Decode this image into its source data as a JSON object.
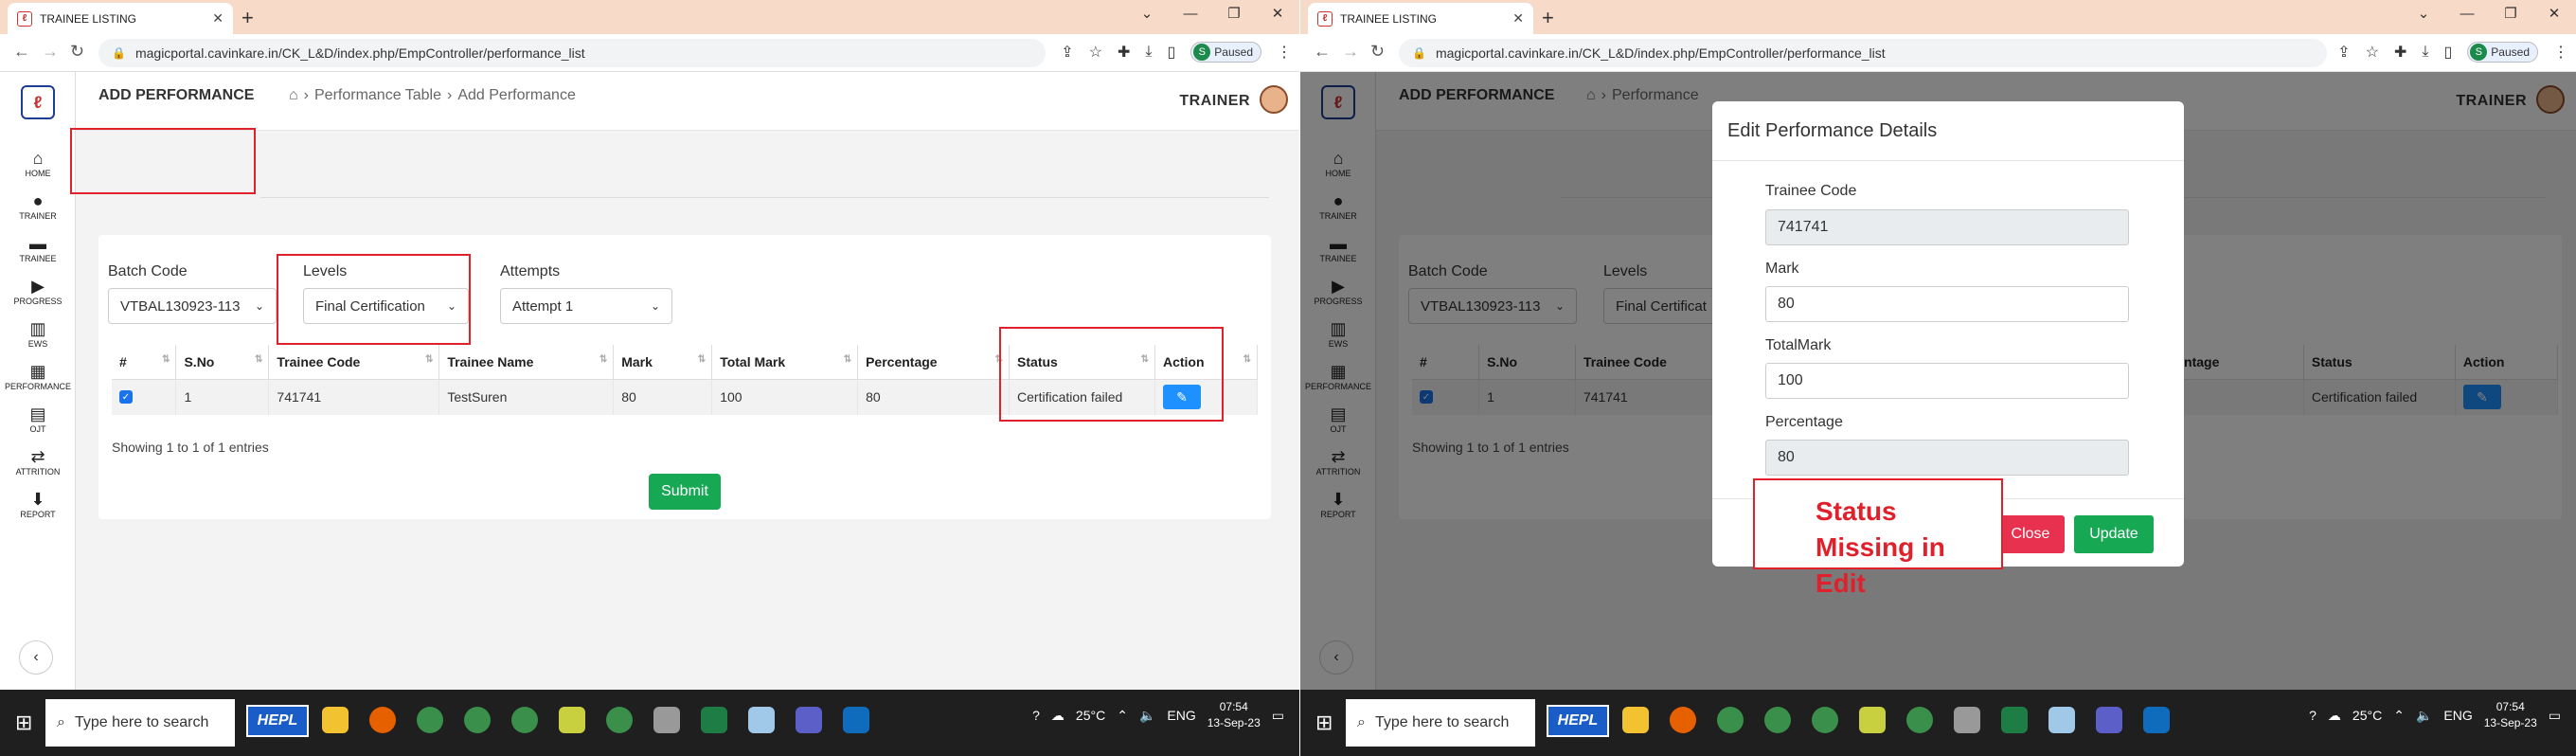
{
  "left": {
    "tab_title": "TRAINEE LISTING",
    "url": "magicportal.cavinkare.in/CK_L&D/index.php/EmpController/performance_list",
    "paused_label": "Paused",
    "profile_initial": "S",
    "trainer": "TRAINER",
    "page_title": "ADD PERFORMANCE",
    "breadcrumb": [
      "Performance Table",
      "Add Performance"
    ],
    "sidebar": [
      {
        "label": "HOME",
        "icon": "home-icon"
      },
      {
        "label": "TRAINER",
        "icon": "user-icon"
      },
      {
        "label": "TRAINEE",
        "icon": "briefcase-icon"
      },
      {
        "label": "PROGRESS",
        "icon": "play-circle-icon"
      },
      {
        "label": "EWS",
        "icon": "bar-chart-icon"
      },
      {
        "label": "PERFORMANCE",
        "icon": "performance-icon"
      },
      {
        "label": "OJT",
        "icon": "document-icon"
      },
      {
        "label": "ATTRITION",
        "icon": "attrition-icon"
      },
      {
        "label": "REPORT",
        "icon": "report-icon"
      }
    ],
    "filters": {
      "batch_label": "Batch Code",
      "batch_value": "VTBAL130923-113",
      "levels_label": "Levels",
      "levels_value": "Final Certification",
      "attempts_label": "Attempts",
      "attempts_value": "Attempt 1"
    },
    "columns": [
      "#",
      "S.No",
      "Trainee Code",
      "Trainee Name",
      "Mark",
      "Total Mark",
      "Percentage",
      "Status",
      "Action"
    ],
    "row": {
      "sno": "1",
      "code": "741741",
      "name": "TestSuren",
      "mark": "80",
      "total": "100",
      "pct": "80",
      "status": "Certification failed"
    },
    "showing": "Showing 1 to 1 of 1 entries",
    "submit": "Submit"
  },
  "right": {
    "tab_title": "TRAINEE LISTING",
    "url": "magicportal.cavinkare.in/CK_L&D/index.php/EmpController/performance_list",
    "paused_label": "Paused",
    "profile_initial": "S",
    "trainer": "TRAINER",
    "page_title": "ADD PERFORMANCE",
    "breadcrumb_partial": "Performance",
    "batch_label": "Batch Code",
    "batch_value": "VTBAL130923-113",
    "levels_label": "Levels",
    "levels_value_partial": "Final Certificat",
    "columns_left": [
      "#",
      "S.No",
      "Trainee Code"
    ],
    "columns_right": [
      "rcentage",
      "Status",
      "Action"
    ],
    "row": {
      "sno": "1",
      "code": "741741",
      "status": "Certification failed"
    },
    "showing": "Showing 1 to 1 of 1 entries",
    "modal": {
      "title": "Edit Performance Details",
      "trainee_code_label": "Trainee Code",
      "trainee_code": "741741",
      "mark_label": "Mark",
      "mark": "80",
      "total_label": "TotalMark",
      "total": "100",
      "pct_label": "Percentage",
      "pct": "80",
      "close": "Close",
      "update": "Update"
    },
    "annotation": "Status Missing in Edit"
  },
  "taskbar": {
    "search_placeholder": "Type here to search",
    "hepl": "HEPL",
    "weather": "25°C",
    "lang": "ENG",
    "time": "07:54",
    "date": "13-Sep-23"
  },
  "colors": {
    "accent_red": "#e0202a",
    "submit_green": "#17a854",
    "close_red": "#e8304f",
    "edit_blue": "#1e90ff"
  }
}
